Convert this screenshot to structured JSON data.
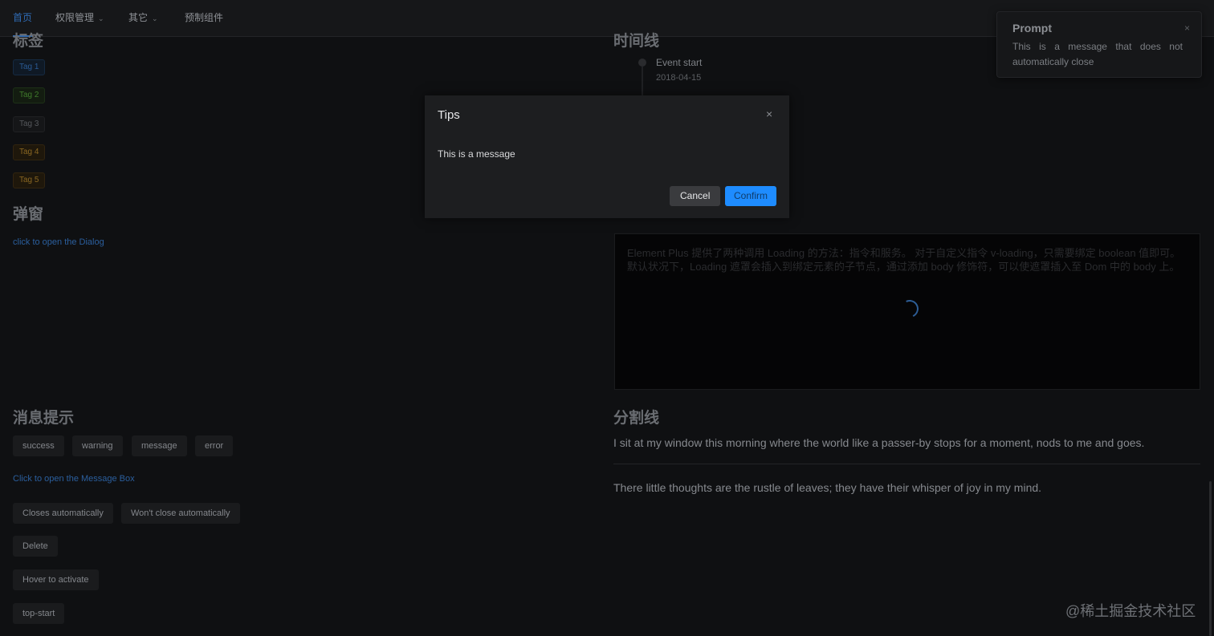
{
  "nav": {
    "items": [
      {
        "label": "首页"
      },
      {
        "label": "权限管理"
      },
      {
        "label": "其它"
      },
      {
        "label": "预制组件"
      }
    ]
  },
  "sections": {
    "tags_heading": "标签",
    "dialog_heading": "弹窗",
    "message_heading": "消息提示",
    "timeline_heading": "时间线",
    "divider_heading": "分割线"
  },
  "tags": [
    "Tag 1",
    "Tag 2",
    "Tag 3",
    "Tag 4",
    "Tag 5"
  ],
  "dialog_section": {
    "open_link": "click to open the Dialog"
  },
  "message_section": {
    "buttons": [
      "success",
      "warning",
      "message",
      "error"
    ],
    "open_box_link": "Click to open the Message Box",
    "notify_buttons": [
      "Closes automatically",
      "Won't close automatically"
    ],
    "delete_button": "Delete",
    "hover_button": "Hover to activate",
    "top_start_button": "top-start"
  },
  "timeline": {
    "event_title": "Event start",
    "event_date": "2018-04-15"
  },
  "loading": {
    "text": "Element Plus 提供了两种调用 Loading 的方法：指令和服务。 对于自定义指令 v-loading，只需要绑定 boolean 值即可。 默认状况下，Loading 遮罩会插入到绑定元素的子节点，通过添加 body 修饰符，可以使遮罩插入至 Dom 中的 body 上。"
  },
  "divider": {
    "line1": "I sit at my window this morning where the world like a passer-by stops for a moment, nods to me and goes.",
    "line2": "There little thoughts are the rustle of leaves; they have their whisper of joy in my mind."
  },
  "modal": {
    "title": "Tips",
    "body": "This is a message",
    "cancel_label": "Cancel",
    "confirm_label": "Confirm",
    "close_icon": "×"
  },
  "notification": {
    "title": "Prompt",
    "message": "This is a message that does not automatically close",
    "close_icon": "×"
  },
  "watermark": "@稀土掘金技术社区",
  "colors": {
    "accent": "#1e8cff",
    "background": "#0f1012"
  }
}
